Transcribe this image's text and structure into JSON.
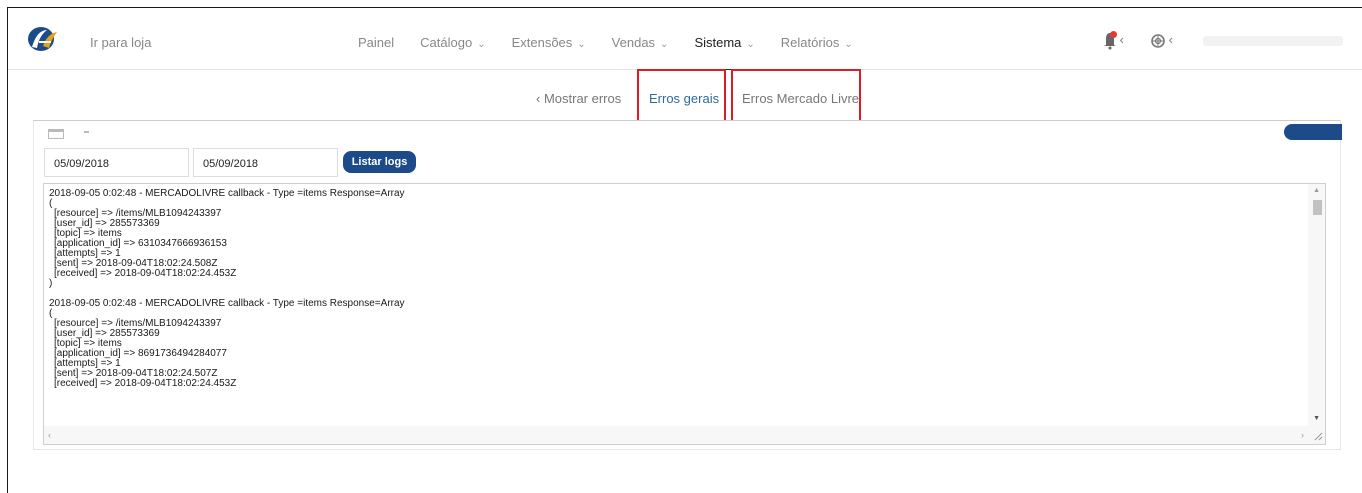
{
  "topbar": {
    "store_link": "Ir para loja",
    "nav": [
      {
        "label": "Painel",
        "dropdown": false
      },
      {
        "label": "Catálogo",
        "dropdown": true
      },
      {
        "label": "Extensões",
        "dropdown": true
      },
      {
        "label": "Vendas",
        "dropdown": true
      },
      {
        "label": "Sistema",
        "dropdown": true,
        "active": true
      },
      {
        "label": "Relatórios",
        "dropdown": true
      }
    ],
    "chevron": "⌄",
    "small_chevron": "‹"
  },
  "subnav": {
    "back_label": "‹ Mostrar erros",
    "tab_general": "Erros gerais",
    "tab_ml": "Erros Mercado Livre"
  },
  "filters": {
    "date_from": "05/09/2018",
    "date_to": "05/09/2018",
    "list_button": "Listar logs"
  },
  "log": {
    "entries": [
      {
        "header": "2018-09-05 0:02:48 - MERCADOLIVRE callback - Type =items Response=Array",
        "open": "(",
        "lines": [
          "[resource] => /items/MLB1094243397",
          "[user_id] => 285573369",
          "[topic] => items",
          "[application_id] => 6310347666936153",
          "[attempts] => 1",
          "[sent] => 2018-09-04T18:02:24.508Z",
          "[received] => 2018-09-04T18:02:24.453Z"
        ],
        "close": ")"
      },
      {
        "header": "2018-09-05 0:02:48 - MERCADOLIVRE callback - Type =items Response=Array",
        "open": "(",
        "lines": [
          "[resource] => /items/MLB1094243397",
          "[user_id] => 285573369",
          "[topic] => items",
          "[application_id] => 8691736494284077",
          "[attempts] => 1",
          "[sent] => 2018-09-04T18:02:24.507Z",
          "[received] => 2018-09-04T18:02:24.453Z"
        ],
        "close": ""
      }
    ]
  },
  "colors": {
    "accent_blue": "#1d4b8a",
    "link_blue": "#2f6aa3",
    "highlight_red": "#e01b24",
    "notification_red": "#e53935"
  }
}
